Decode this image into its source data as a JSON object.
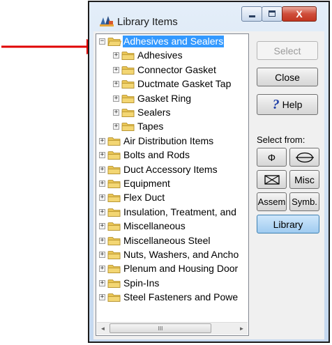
{
  "window": {
    "title": "Library Items",
    "controls": {
      "close_glyph": "X"
    }
  },
  "tree": {
    "items": [
      {
        "label": "Adhesives and Sealers",
        "level": 0,
        "expanded": true,
        "selected": true
      },
      {
        "label": "Adhesives",
        "level": 1,
        "expanded": false,
        "selected": false
      },
      {
        "label": "Connector Gasket",
        "level": 1,
        "expanded": false,
        "selected": false
      },
      {
        "label": "Ductmate Gasket Tap",
        "level": 1,
        "expanded": false,
        "selected": false
      },
      {
        "label": "Gasket Ring",
        "level": 1,
        "expanded": false,
        "selected": false
      },
      {
        "label": "Sealers",
        "level": 1,
        "expanded": false,
        "selected": false
      },
      {
        "label": "Tapes",
        "level": 1,
        "expanded": false,
        "selected": false
      },
      {
        "label": "Air Distribution Items",
        "level": 0,
        "expanded": false,
        "selected": false
      },
      {
        "label": "Bolts and Rods",
        "level": 0,
        "expanded": false,
        "selected": false
      },
      {
        "label": "Duct Accessory Items",
        "level": 0,
        "expanded": false,
        "selected": false
      },
      {
        "label": "Equipment",
        "level": 0,
        "expanded": false,
        "selected": false
      },
      {
        "label": "Flex Duct",
        "level": 0,
        "expanded": false,
        "selected": false
      },
      {
        "label": "Insulation, Treatment, and",
        "level": 0,
        "expanded": false,
        "selected": false
      },
      {
        "label": "Miscellaneous",
        "level": 0,
        "expanded": false,
        "selected": false
      },
      {
        "label": "Miscellaneous Steel",
        "level": 0,
        "expanded": false,
        "selected": false
      },
      {
        "label": "Nuts, Washers, and Ancho",
        "level": 0,
        "expanded": false,
        "selected": false
      },
      {
        "label": "Plenum and Housing Door",
        "level": 0,
        "expanded": false,
        "selected": false
      },
      {
        "label": "Spin-Ins",
        "level": 0,
        "expanded": false,
        "selected": false
      },
      {
        "label": "Steel Fasteners and Powe",
        "level": 0,
        "expanded": false,
        "selected": false
      }
    ],
    "scrollbar": {
      "left_arrow": "◄",
      "right_arrow": "►",
      "grip": "III"
    }
  },
  "buttons": {
    "select": "Select",
    "close": "Close",
    "help": "Help",
    "help_glyph": "?",
    "select_from": "Select from:",
    "round_symbol": "Φ",
    "misc": "Misc",
    "assem": "Assem",
    "symb": "Symb.",
    "library": "Library"
  },
  "colors": {
    "selection": "#3399ff",
    "arrow": "#e00000",
    "folder": "#f3d673",
    "library_button": "#9fcbf0"
  },
  "icons": {
    "app": "library-items-app-icon",
    "folder": "folder-icon",
    "expander_plus": "+",
    "expander_minus": "−"
  }
}
